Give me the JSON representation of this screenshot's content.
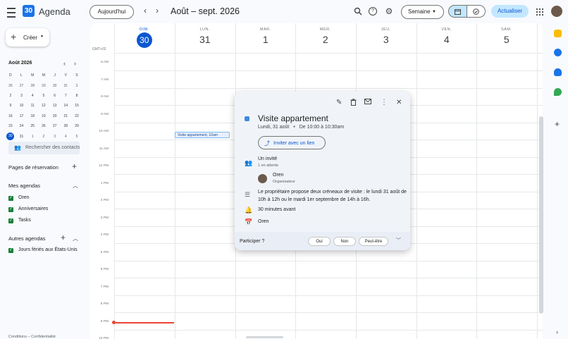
{
  "header": {
    "app_name": "Agenda",
    "logo_day": "30",
    "today_button": "Aujourd'hui",
    "range_title": "Août – sept. 2026",
    "view_select": "Semaine",
    "update_button": "Actualiser"
  },
  "sidebar": {
    "create_button": "Créer",
    "mini_calendar": {
      "title": "Août 2026",
      "weekday_headers": [
        "D",
        "L",
        "M",
        "M",
        "J",
        "V",
        "S"
      ],
      "weeks": [
        [
          "26",
          "27",
          "28",
          "29",
          "30",
          "31",
          "1"
        ],
        [
          "2",
          "3",
          "4",
          "5",
          "6",
          "7",
          "8"
        ],
        [
          "9",
          "10",
          "11",
          "12",
          "13",
          "14",
          "15"
        ],
        [
          "16",
          "17",
          "18",
          "19",
          "20",
          "21",
          "22"
        ],
        [
          "23",
          "24",
          "25",
          "26",
          "27",
          "28",
          "29"
        ],
        [
          "30",
          "31",
          "1",
          "2",
          "3",
          "4",
          "5"
        ]
      ]
    },
    "search_people_placeholder": "Rechercher des contacts",
    "booking_pages": "Pages de réservation",
    "my_calendars_title": "Mes agendas",
    "my_calendars": [
      "Oren",
      "Anniversaires",
      "Tasks"
    ],
    "other_calendars_title": "Autres agendas",
    "other_calendars": [
      "Jours fériés aux États-Unis"
    ],
    "footer": "Conditions – Confidentialité"
  },
  "grid": {
    "timezone": "GMT+02",
    "days": [
      {
        "dow": "DIM.",
        "num": "30",
        "today": true
      },
      {
        "dow": "LUN.",
        "num": "31"
      },
      {
        "dow": "MAR.",
        "num": "1"
      },
      {
        "dow": "MER.",
        "num": "2"
      },
      {
        "dow": "JEU.",
        "num": "3"
      },
      {
        "dow": "VEN.",
        "num": "4"
      },
      {
        "dow": "SAM.",
        "num": "5"
      }
    ],
    "hours": [
      "6 AM",
      "7 AM",
      "8 AM",
      "9 AM",
      "10 AM",
      "11 AM",
      "12 PM",
      "1 PM",
      "2 PM",
      "3 PM",
      "4 PM",
      "5 PM",
      "6 PM",
      "7 PM",
      "8 PM",
      "9 PM",
      "10 PM"
    ],
    "event_chip": "Visite appartement, 10am"
  },
  "popup": {
    "title": "Visite appartement",
    "date": "Lundi, 31 août",
    "separator": "•",
    "time": "De 10:00 à 10:30am",
    "invite_button": "Inviter avec un lien",
    "guests_title": "Un invité",
    "guests_status": "1 en attente",
    "organizer_name": "Oren",
    "organizer_role": "Organisateur",
    "description": "Le propriétaire propose deux créneaux de visite : le lundi 31 août de 10h à 12h ou le mardi 1er septembre de 14h à 16h.",
    "reminder": "30 minutes avant",
    "calendar": "Oren",
    "rsvp_question": "Participer ?",
    "rsvp_yes": "Oui",
    "rsvp_no": "Non",
    "rsvp_maybe": "Peut-être"
  },
  "colors": {
    "accent": "#0b57d0",
    "event": "#3f8ae0",
    "now_line": "#ea4335",
    "calendar_checkbox": "#188038"
  }
}
